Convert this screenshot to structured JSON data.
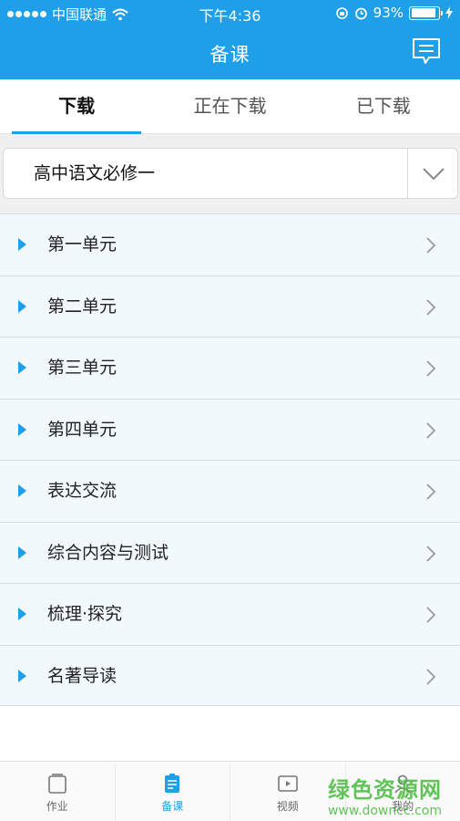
{
  "status": {
    "carrier": "中国联通",
    "time": "下午4:36",
    "battery": "93%",
    "battery_level": 0.93
  },
  "nav": {
    "title": "备课",
    "message_icon": "message-icon"
  },
  "tabs": [
    {
      "label": "下载",
      "active": true
    },
    {
      "label": "正在下载",
      "active": false
    },
    {
      "label": "已下载",
      "active": false
    }
  ],
  "book_select": {
    "value": "高中语文必修一"
  },
  "units": [
    {
      "label": "第一单元"
    },
    {
      "label": "第二单元"
    },
    {
      "label": "第三单元"
    },
    {
      "label": "第四单元"
    },
    {
      "label": "表达交流"
    },
    {
      "label": "综合内容与测试"
    },
    {
      "label": "梳理·探究"
    },
    {
      "label": "名著导读"
    }
  ],
  "tabbar": [
    {
      "label": "作业",
      "icon": "homework-icon",
      "active": false
    },
    {
      "label": "备课",
      "icon": "lesson-prep-icon",
      "active": true
    },
    {
      "label": "视频",
      "icon": "video-icon",
      "active": false
    },
    {
      "label": "我的",
      "icon": "profile-icon",
      "active": false
    }
  ],
  "watermark": {
    "line1": "绿色资源网",
    "line2": "www.downcc.com"
  },
  "colors": {
    "primary": "#1e9fe8",
    "list_bg": "#f2f9fd"
  }
}
